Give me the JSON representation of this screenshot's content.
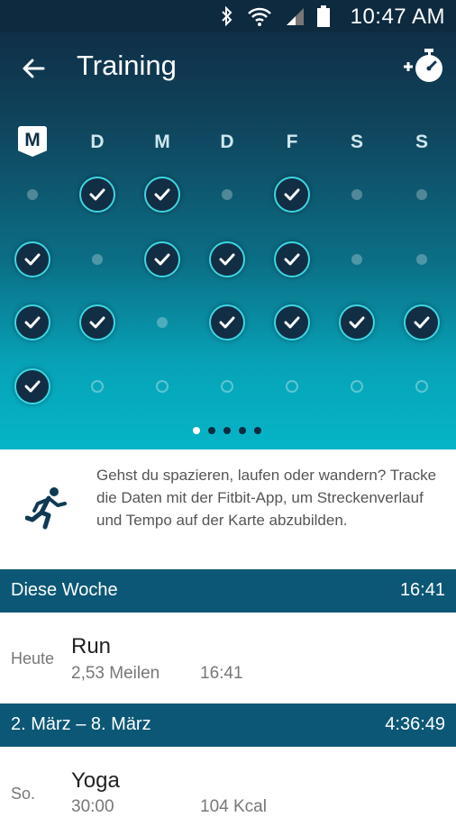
{
  "status_bar": {
    "time": "10:47 AM",
    "icons": [
      "bluetooth-icon",
      "wifi-icon",
      "signal-icon",
      "battery-icon"
    ]
  },
  "app_bar": {
    "title": "Training",
    "back_icon": "arrow-left-icon",
    "action_icon": "add-stopwatch-icon"
  },
  "week_days": [
    {
      "label": "M",
      "current": true
    },
    {
      "label": "D"
    },
    {
      "label": "M"
    },
    {
      "label": "D"
    },
    {
      "label": "F"
    },
    {
      "label": "S"
    },
    {
      "label": "S"
    }
  ],
  "activity_grid": [
    [
      "dot",
      "check",
      "check",
      "dot",
      "check",
      "dot",
      "dot"
    ],
    [
      "check",
      "dot",
      "check",
      "check",
      "check",
      "dot",
      "dot"
    ],
    [
      "check",
      "check",
      "dot",
      "check",
      "check",
      "check",
      "check"
    ],
    [
      "check",
      "ring",
      "ring",
      "ring",
      "ring",
      "ring",
      "ring"
    ]
  ],
  "pager": {
    "count": 5,
    "active": 0
  },
  "info_card": {
    "text": "Gehst du spazieren, laufen oder wandern? Tracke die Daten mit der Fitbit-App, um Streckenverlauf und Tempo auf der Karte abzubilden.",
    "icon": "runner-icon"
  },
  "sections": [
    {
      "label": "Diese Woche",
      "total": "16:41",
      "items": [
        {
          "day": "Heute",
          "name": "Run",
          "value1": "2,53 Meilen",
          "value2": "16:41"
        }
      ]
    },
    {
      "label": "2. März – 8. März",
      "total": "4:36:49",
      "items": [
        {
          "day": "So.",
          "name": "Yoga",
          "value1": "30:00",
          "value2": "104 Kcal"
        }
      ]
    }
  ],
  "colors": {
    "header_dark": "#0f2f47",
    "hero_light": "#05b5c7",
    "section_bar": "#0c5775",
    "check_ring": "#3dd6e3"
  }
}
